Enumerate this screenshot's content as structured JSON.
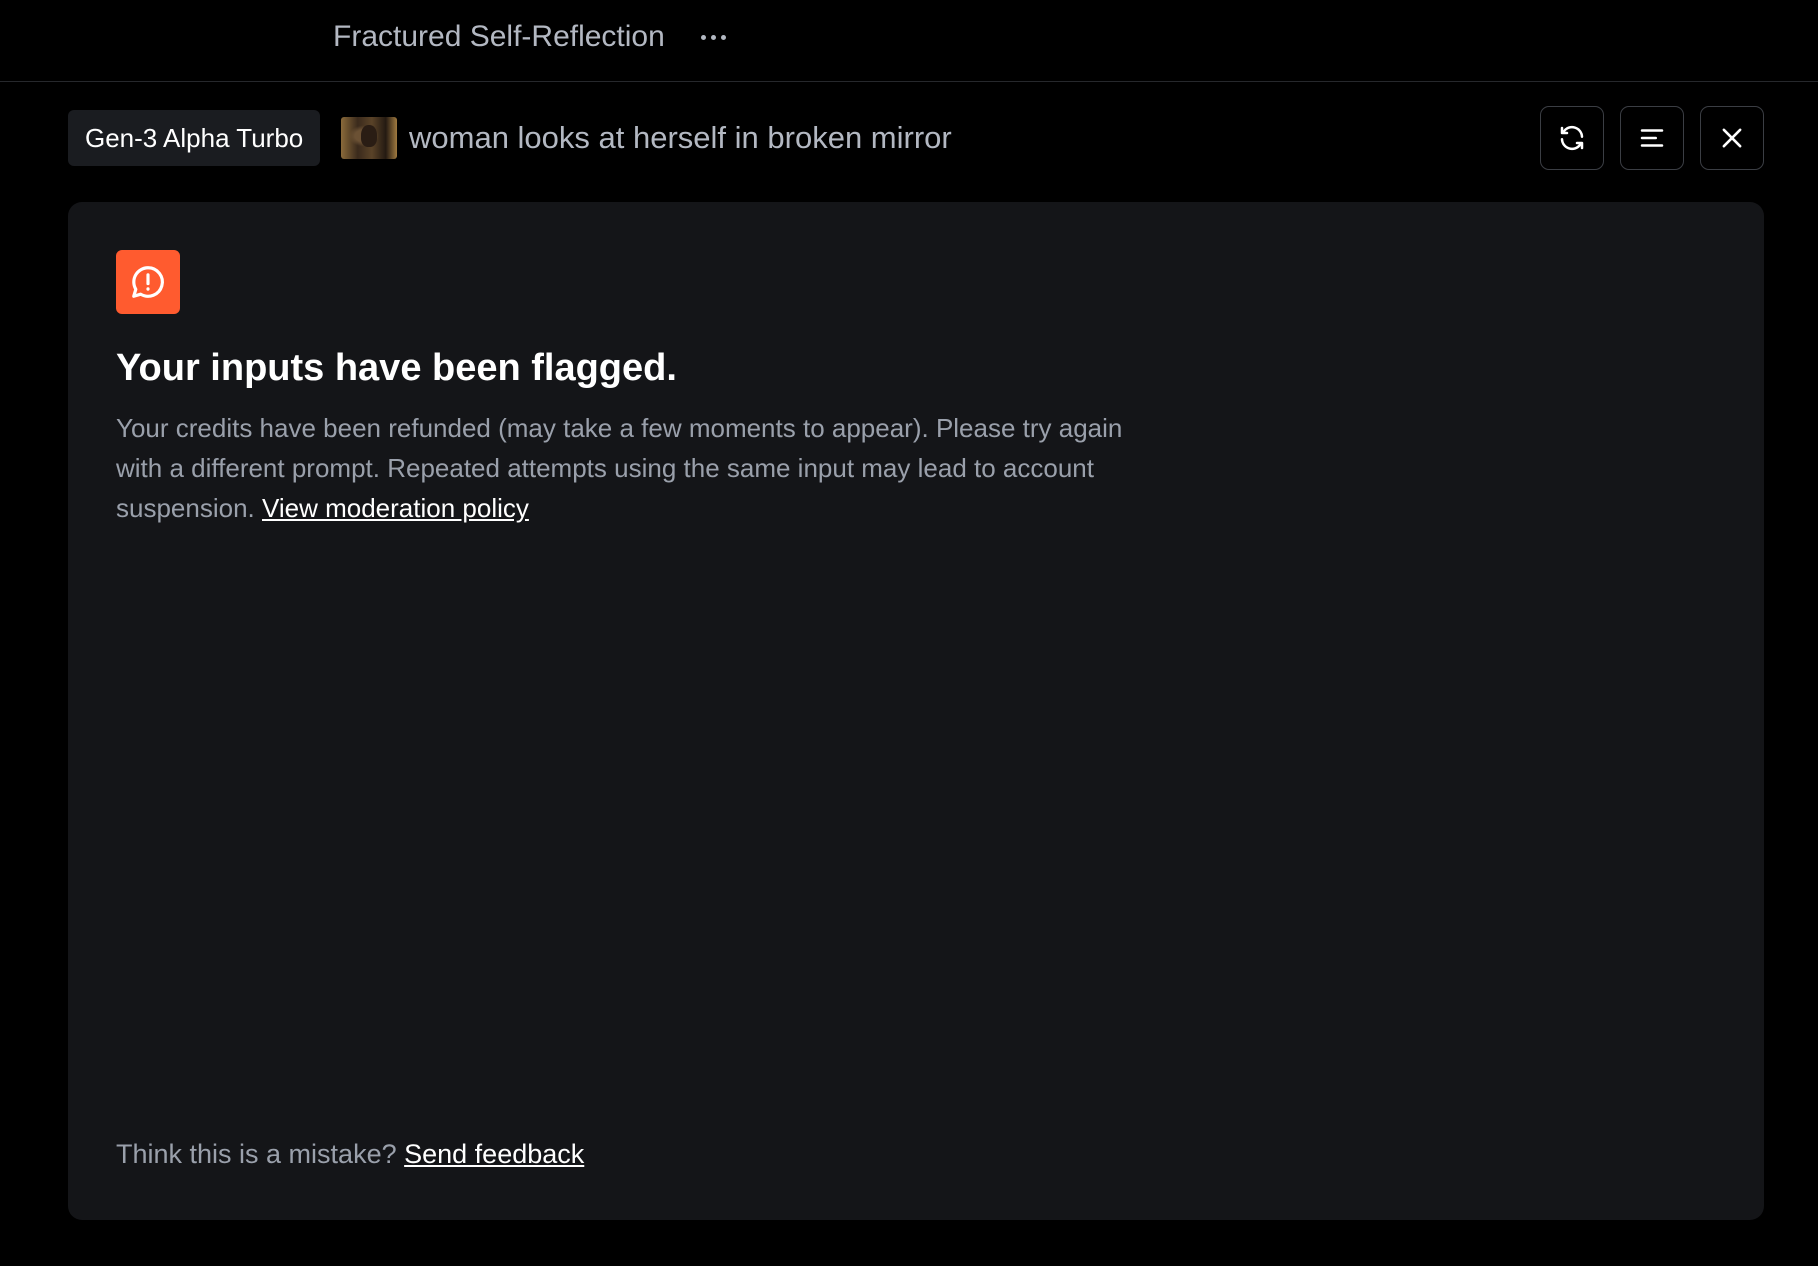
{
  "topbar": {
    "project_title": "Fractured Self-Reflection",
    "more_icon": "more-horizontal-icon"
  },
  "generation": {
    "model": "Gen-3 Alpha Turbo",
    "prompt": "woman looks at herself in broken mirror",
    "thumbnail_alt": "reference image thumbnail"
  },
  "actions": {
    "refresh_icon": "refresh-icon",
    "menu_icon": "menu-lines-icon",
    "close_icon": "close-icon"
  },
  "alert": {
    "icon": "alert-message-icon",
    "icon_color": "#ff5b2f",
    "title": "Your inputs have been flagged.",
    "body": "Your credits have been refunded (may take a few moments to appear). Please try again with a different prompt. Repeated attempts using the same input may lead to account suspension.",
    "policy_link": "View moderation policy"
  },
  "feedback": {
    "text": "Think this is a mistake?",
    "link": "Send feedback"
  }
}
